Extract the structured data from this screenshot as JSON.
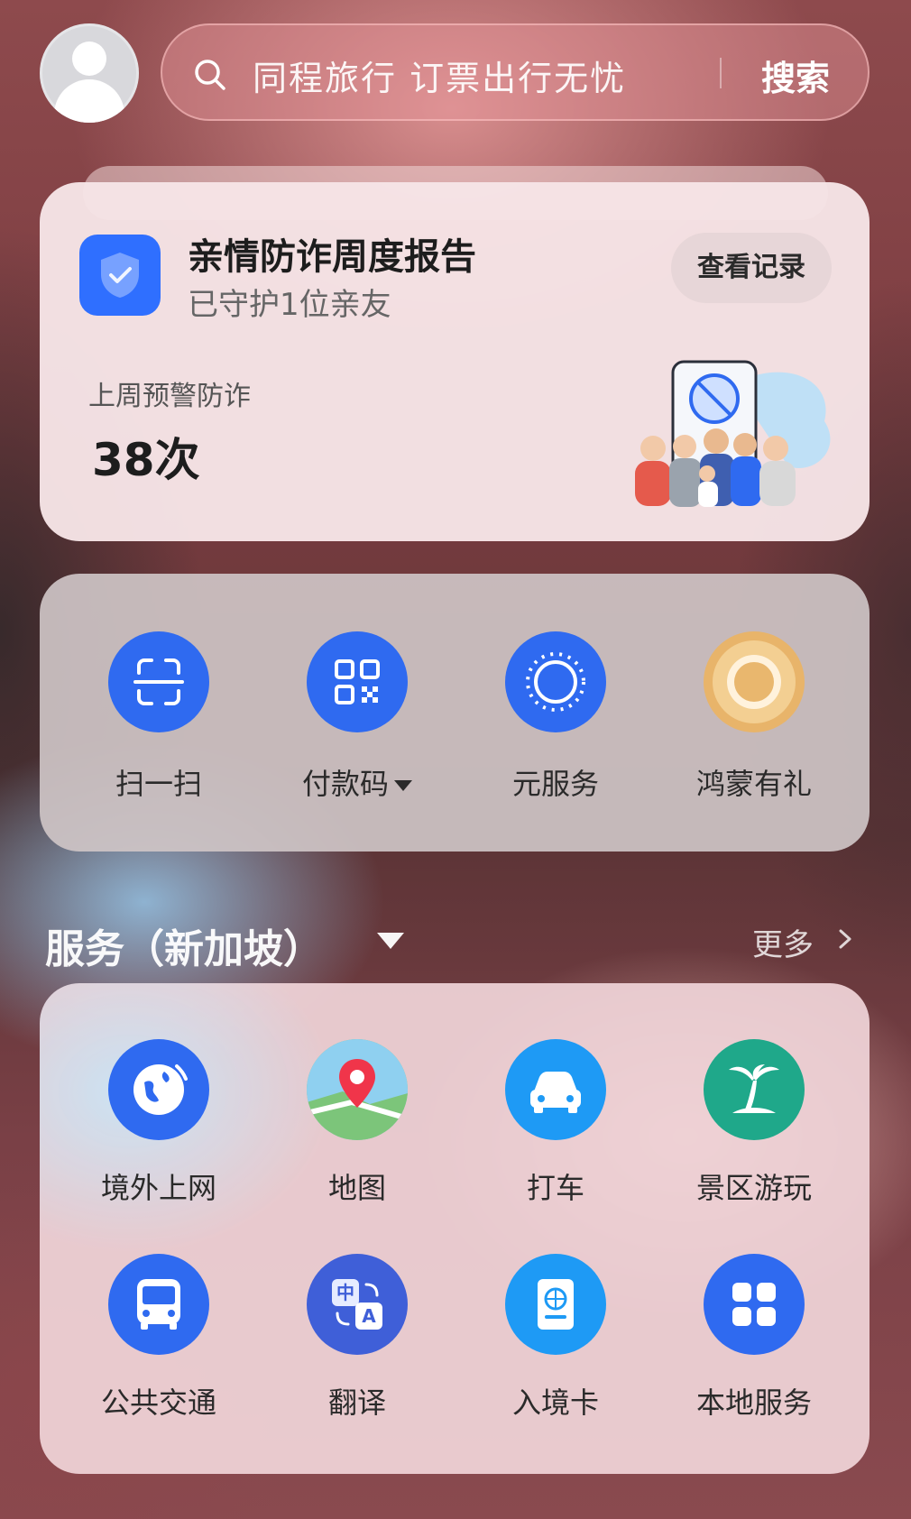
{
  "search": {
    "placeholder": "同程旅行 订票出行无忧",
    "button": "搜索"
  },
  "report": {
    "title": "亲情防诈周度报告",
    "subtitle": "已守护1位亲友",
    "record_button": "查看记录",
    "warn_label": "上周预警防诈",
    "warn_count": "38次"
  },
  "quick_actions": [
    {
      "label": "扫一扫",
      "icon": "scan-icon"
    },
    {
      "label": "付款码",
      "icon": "qr-code-icon"
    },
    {
      "label": "元服务",
      "icon": "atomic-service-icon"
    },
    {
      "label": "鸿蒙有礼",
      "icon": "gift-ring-icon"
    }
  ],
  "services": {
    "title": "服务（新加坡）",
    "more": "更多",
    "items": [
      {
        "label": "境外上网",
        "icon": "globe-icon"
      },
      {
        "label": "地图",
        "icon": "map-pin-icon"
      },
      {
        "label": "打车",
        "icon": "car-icon"
      },
      {
        "label": "景区游玩",
        "icon": "palm-tree-icon"
      },
      {
        "label": "公共交通",
        "icon": "bus-icon"
      },
      {
        "label": "翻译",
        "icon": "translate-icon"
      },
      {
        "label": "入境卡",
        "icon": "passport-icon"
      },
      {
        "label": "本地服务",
        "icon": "grid-icon"
      }
    ]
  },
  "colors": {
    "primary_blue": "#2f6af0",
    "gold": "#e8b46a",
    "teal": "#1fa88a"
  }
}
